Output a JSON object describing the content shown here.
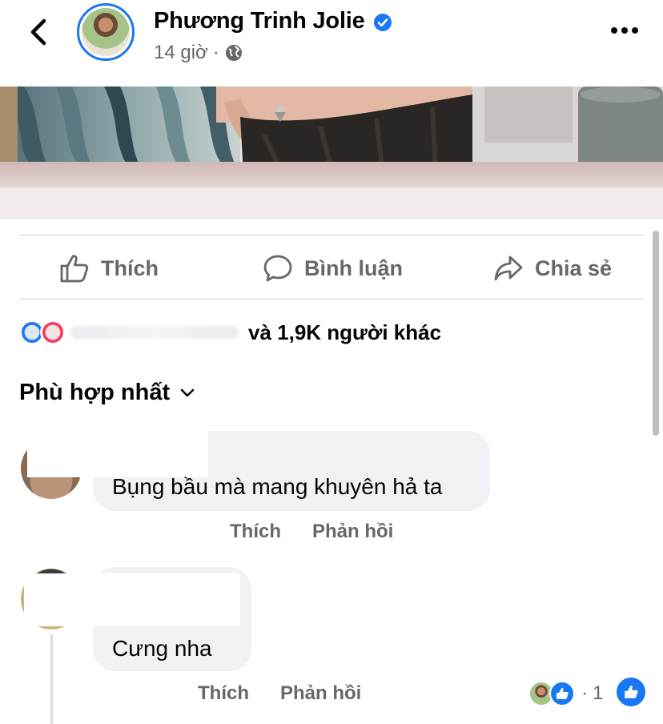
{
  "header": {
    "poster_name": "Phương Trinh Jolie",
    "time": "14 giờ",
    "separator": "·",
    "verified_color": "#1877f2"
  },
  "actions": {
    "like": "Thích",
    "comment": "Bình luận",
    "share": "Chia sẻ"
  },
  "reactions": {
    "summary_text": "và 1,9K người khác"
  },
  "sort": {
    "label": "Phù hợp nhất"
  },
  "comments": [
    {
      "text": "Bụng bầu mà mang khuyên hả ta",
      "like": "Thích",
      "reply": "Phản hồi"
    },
    {
      "text": "Cưng nha",
      "like": "Thích",
      "reply": "Phản hồi",
      "reaction_separator": "·",
      "reaction_count": "1"
    }
  ],
  "colors": {
    "accent": "#1877f2",
    "secondary_text": "#65676b",
    "bubble": "#f0f2f5"
  }
}
